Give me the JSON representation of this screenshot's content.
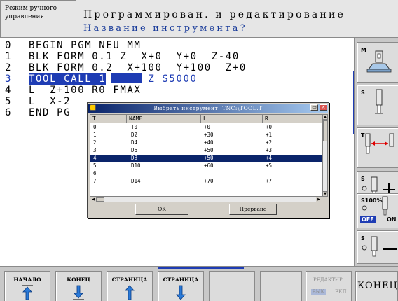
{
  "header": {
    "mode_line1": "Режим ручного",
    "mode_line2": "управления",
    "title": "Программирован. и редактирование",
    "prompt": "Название инструмента?"
  },
  "program": {
    "lines": [
      {
        "num": "0",
        "text": "BEGIN PGM NEU MM"
      },
      {
        "num": "1",
        "text": "BLK FORM 0.1 Z  X+0  Y+0  Z-40"
      },
      {
        "num": "2",
        "text": "BLK FORM 0.2  X+100  Y+100  Z+0"
      },
      {
        "num": "3",
        "text": "TOOL CALL 1",
        "rest": "Z S5000"
      },
      {
        "num": "4",
        "text": "L  Z+100 R0 FMAX"
      },
      {
        "num": "5",
        "text": "L  X-2"
      },
      {
        "num": "6",
        "text": "END PG"
      }
    ]
  },
  "dialog": {
    "title": "Выбрать инструмент: TNC:\\TOOL.T",
    "columns": [
      "T",
      "NAME",
      "L",
      "R"
    ],
    "rows": [
      [
        "0",
        "T0",
        "+0",
        "+0"
      ],
      [
        "1",
        "D2",
        "+30",
        "+1"
      ],
      [
        "2",
        "D4",
        "+40",
        "+2"
      ],
      [
        "3",
        "D6",
        "+50",
        "+3"
      ],
      [
        "4",
        "D8",
        "+50",
        "+4"
      ],
      [
        "5",
        "D10",
        "+60",
        "+5"
      ],
      [
        "6",
        "",
        "",
        ""
      ],
      [
        "7",
        "D14",
        "+70",
        "+7"
      ]
    ],
    "selected_row": 4,
    "ok_label": "OK",
    "cancel_label": "Прерване"
  },
  "right_keys": {
    "m_label": "M",
    "s1_label": "S",
    "t_label": "T",
    "s2_label": "S",
    "s100_label": "S100%",
    "off_label": "OFF",
    "on_label": "ON",
    "s3_label": "S"
  },
  "bottom_keys": {
    "start": "НАЧАЛО",
    "end": "КОНЕЦ",
    "page_up": "СТРАНИЦА",
    "page_down": "СТРАНИЦА",
    "edit_line1": "РЕДАКТИР.",
    "edit_off": "ВЫК",
    "edit_on": "ВКЛ",
    "finish": "КОНЕЦ"
  },
  "colors": {
    "accent": "#1e3cb4",
    "selection": "#0a246a",
    "background": "#c0c0c0"
  }
}
